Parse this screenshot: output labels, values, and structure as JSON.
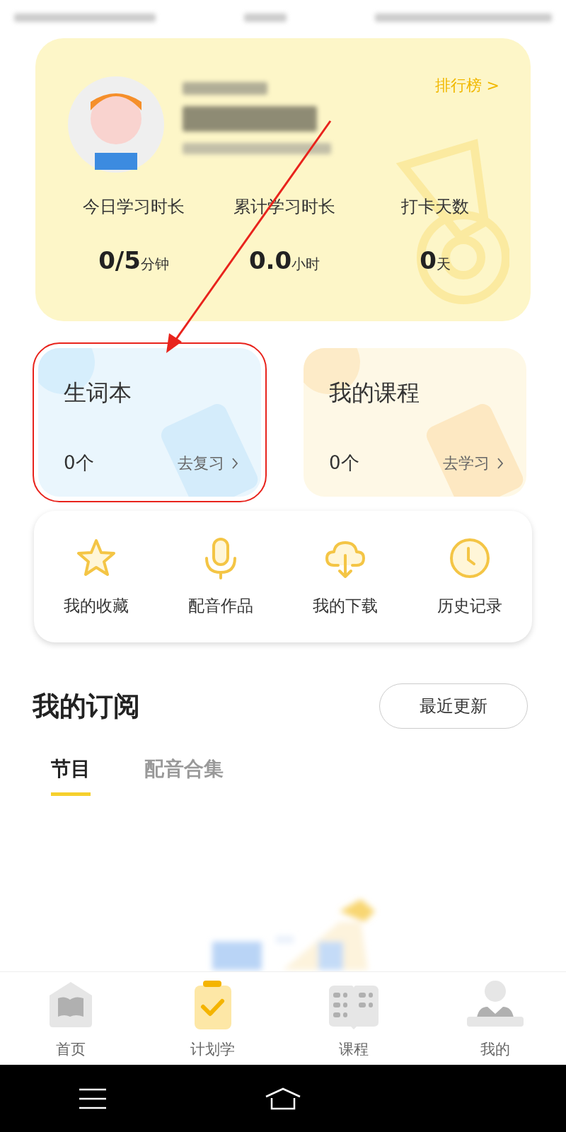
{
  "profile_card": {
    "ranking_link": "排行榜 >",
    "stats": [
      {
        "label": "今日学习时长",
        "value": "0/5",
        "unit": "分钟"
      },
      {
        "label": "累计学习时长",
        "value": "0.0",
        "unit": "小时"
      },
      {
        "label": "打卡天数",
        "value": "0",
        "unit": "天"
      }
    ]
  },
  "cards": [
    {
      "kind": "words",
      "title": "生词本",
      "count": "0个",
      "action": "去复习",
      "highlighted": true
    },
    {
      "kind": "courses",
      "title": "我的课程",
      "count": "0个",
      "action": "去学习",
      "highlighted": false
    }
  ],
  "shortcuts": [
    {
      "kind": "star",
      "label": "我的收藏"
    },
    {
      "kind": "mic",
      "label": "配音作品"
    },
    {
      "kind": "download",
      "label": "我的下载"
    },
    {
      "kind": "clock",
      "label": "历史记录"
    }
  ],
  "subscriptions": {
    "title": "我的订阅",
    "sort_button": "最近更新",
    "tabs": [
      {
        "label": "节目",
        "selected": true
      },
      {
        "label": "配音合集",
        "selected": false
      }
    ]
  },
  "tab_bar": [
    {
      "kind": "home",
      "label": "首页",
      "selected": false
    },
    {
      "kind": "plan",
      "label": "计划学",
      "selected": true
    },
    {
      "kind": "course",
      "label": "课程",
      "selected": false
    },
    {
      "kind": "me",
      "label": "我的",
      "selected": false
    }
  ]
}
